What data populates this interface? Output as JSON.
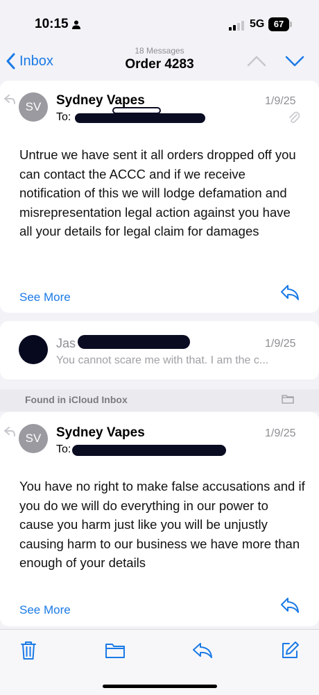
{
  "status": {
    "time": "10:15",
    "network": "5G",
    "battery": "67"
  },
  "nav": {
    "back_label": "Inbox",
    "message_count": "18 Messages",
    "title": "Order 4283"
  },
  "messages": [
    {
      "avatar": "SV",
      "sender": "Sydney Vapes",
      "to_label": "To:",
      "date": "1/9/25",
      "body": "Untrue we have sent it all orders dropped off you can contact the ACCC and if we receive notification of this we will lodge defamation and misrepresentation legal action against you have all your details for legal claim for damages",
      "see_more": "See More"
    },
    {
      "sender": "Jas",
      "date": "1/9/25",
      "preview": "You cannot scare me with that. I am the c..."
    },
    {
      "avatar": "SV",
      "sender": "Sydney Vapes",
      "to_label": "To:",
      "date": "1/9/25",
      "body": "You have no right to make false accusations and if you do we will do everything in our power to cause you harm just like you will be unjustly causing harm to our business we have more than enough of your details",
      "see_more": "See More"
    }
  ],
  "found_in": "Found in iCloud Inbox",
  "icons": {
    "accent": "#1a7ae6",
    "toolbar": [
      "trash-icon",
      "folder-icon",
      "reply-icon",
      "compose-icon"
    ]
  }
}
